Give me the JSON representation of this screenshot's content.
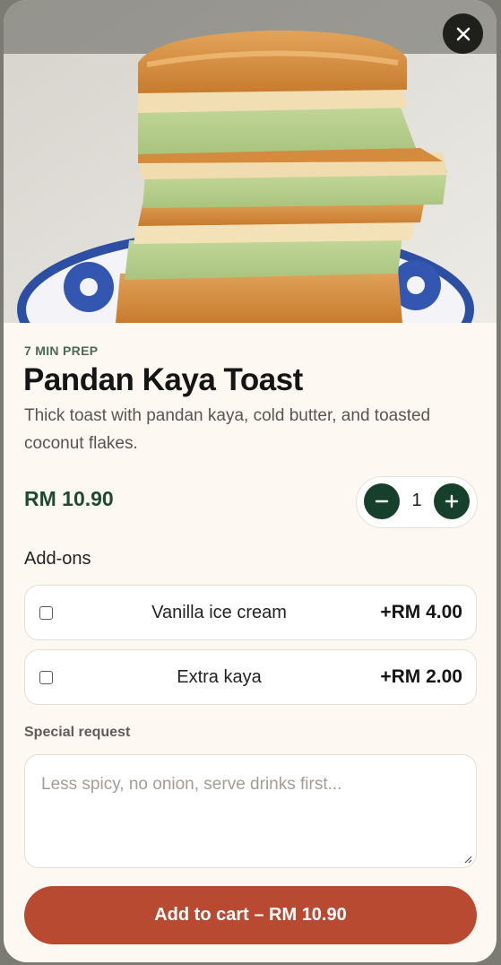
{
  "hero": {
    "image": "pandan kaya toast photo"
  },
  "close": {
    "icon": "close-icon"
  },
  "item": {
    "prep": "7 MIN PREP",
    "name": "Pandan Kaya Toast",
    "description": "Thick toast with pandan kaya, cold butter, and toasted coconut flakes.",
    "price": "RM 10.90"
  },
  "quantity": {
    "value": "1",
    "minus_icon": "minus-icon",
    "plus_icon": "plus-icon"
  },
  "addons": {
    "label": "Add-ons",
    "items": [
      {
        "name": "Vanilla ice cream",
        "price": "+RM 4.00",
        "checked": false
      },
      {
        "name": "Extra kaya",
        "price": "+RM 2.00",
        "checked": false
      }
    ]
  },
  "special_request": {
    "label": "Special request",
    "placeholder": "Less spicy, no onion, serve drinks first..."
  },
  "cart": {
    "button_label": "Add to cart – RM 10.90"
  },
  "colors": {
    "accent_green": "#16402c",
    "cart_button": "#b94a32",
    "sheet_background": "#fdf8f1"
  }
}
